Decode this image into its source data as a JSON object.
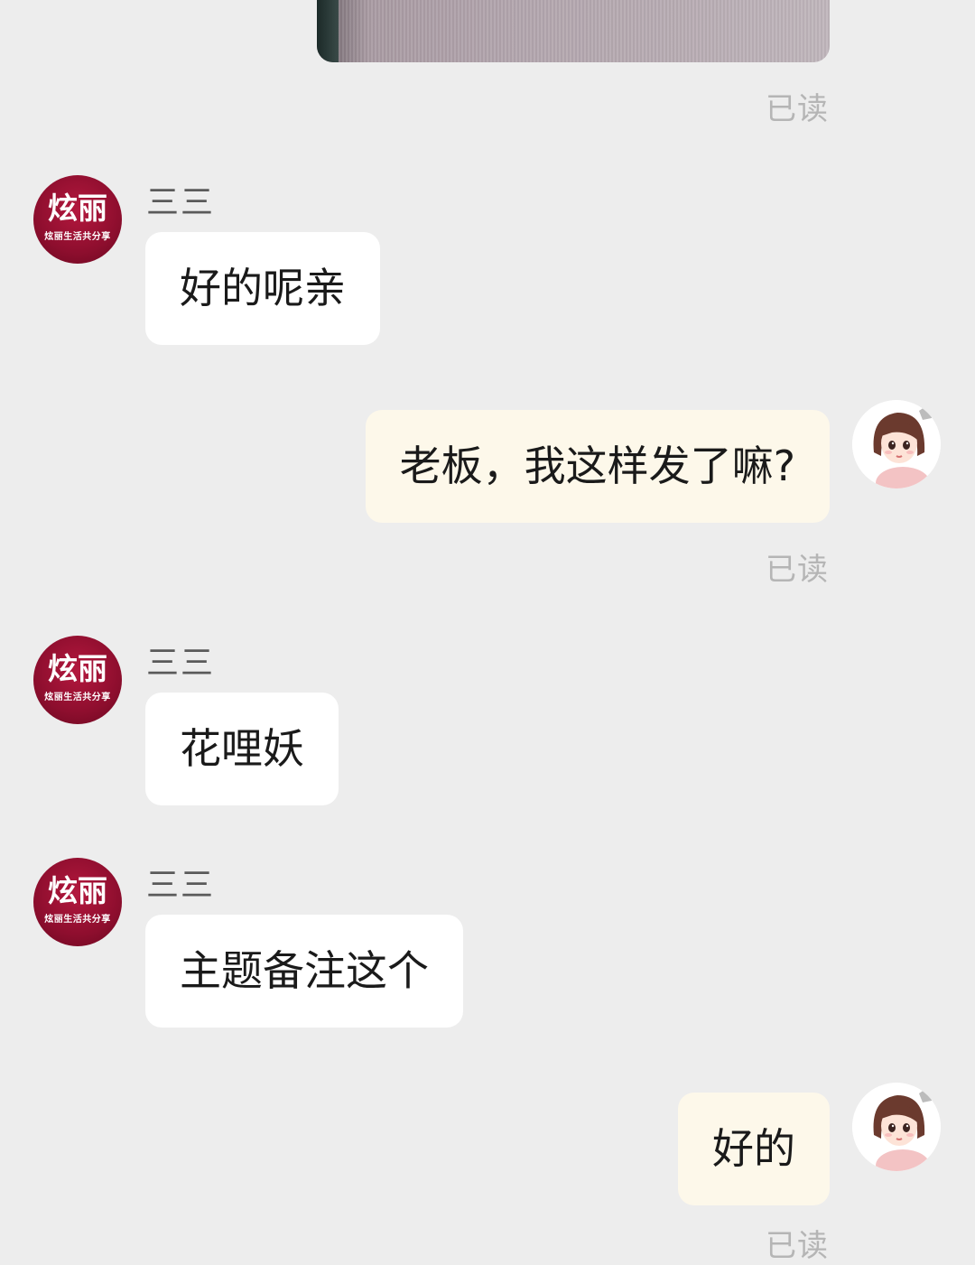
{
  "messages": [
    {
      "type": "image",
      "direction": "out",
      "read_status": "已读"
    },
    {
      "type": "text",
      "direction": "in",
      "sender": "三三",
      "avatar_text": "炫丽",
      "avatar_subtext": "炫丽生活共分享",
      "text": "好的呢亲"
    },
    {
      "type": "text",
      "direction": "out",
      "text": "老板，我这样发了嘛?",
      "read_status": "已读"
    },
    {
      "type": "text",
      "direction": "in",
      "sender": "三三",
      "avatar_text": "炫丽",
      "avatar_subtext": "炫丽生活共分享",
      "text": "花哩妖"
    },
    {
      "type": "text",
      "direction": "in",
      "sender": "三三",
      "avatar_text": "炫丽",
      "avatar_subtext": "炫丽生活共分享",
      "text": "主题备注这个"
    },
    {
      "type": "text",
      "direction": "out",
      "text": "好的",
      "read_status": "已读"
    }
  ],
  "colors": {
    "background": "#ededed",
    "incoming_bubble": "#ffffff",
    "outgoing_bubble": "#fdf8ea",
    "shop_avatar": "#a0123a",
    "read_text": "#b5b5b5"
  },
  "icons": {
    "shop_avatar": "brand-logo-avatar",
    "user_avatar": "cartoon-girl-avatar"
  }
}
